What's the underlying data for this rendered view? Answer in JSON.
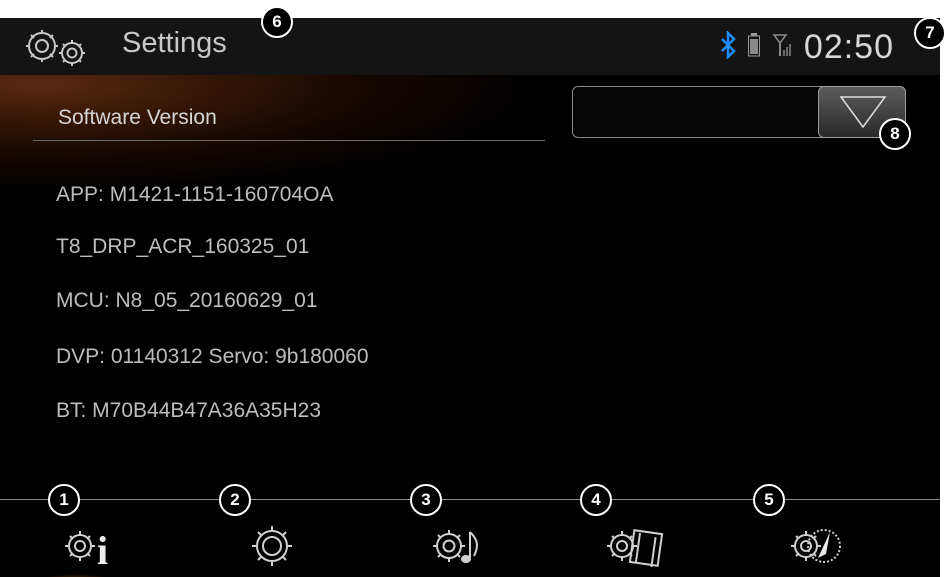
{
  "header": {
    "title": "Settings",
    "clock": "02:50",
    "bluetooth_icon": "bluetooth-icon",
    "battery_icon": "battery-icon",
    "signal_icon": "signal-icon"
  },
  "section": {
    "title": "Software Version"
  },
  "dropdown": {
    "value": "",
    "icon": "triangle-down-icon"
  },
  "info": [
    "APP: M1421-1151-160704OA",
    "T8_DRP_ACR_160325_01",
    "MCU: N8_05_20160629_01",
    "DVP: 01140312 Servo: 9b180060",
    "BT:  M70B44B47A36A35H23"
  ],
  "dock": [
    {
      "icon": "gear-info-icon",
      "active": true
    },
    {
      "icon": "gear-icon",
      "active": false
    },
    {
      "icon": "gear-music-icon",
      "active": false
    },
    {
      "icon": "gear-film-icon",
      "active": false
    },
    {
      "icon": "gear-compass-icon",
      "active": false
    }
  ],
  "badges": [
    "1",
    "2",
    "3",
    "4",
    "5",
    "6",
    "7",
    "8"
  ],
  "colors": {
    "accent_bluetooth": "#1f8cff",
    "active_glow": "#c87a1a",
    "background": "#000000"
  }
}
